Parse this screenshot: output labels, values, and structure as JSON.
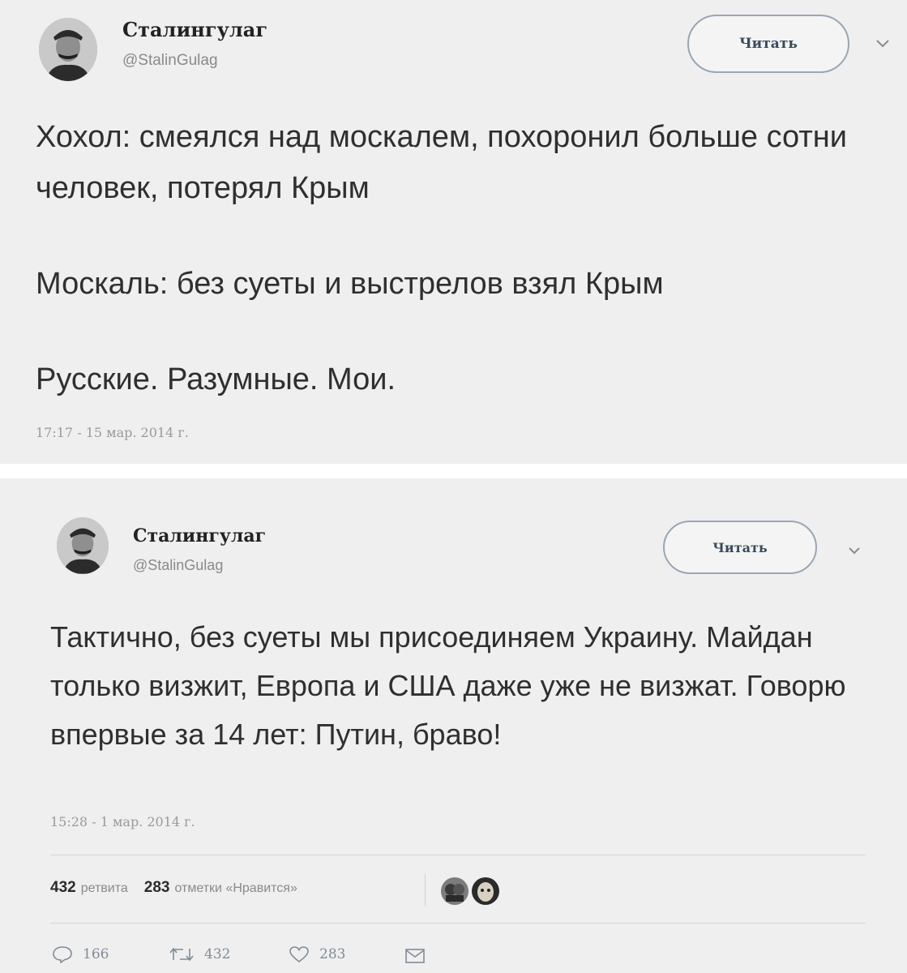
{
  "tweets": [
    {
      "author": {
        "name": "Сталингулаг",
        "handle": "@StalinGulag"
      },
      "follow_label": "Читать",
      "menu_icon": "chevron-down-icon",
      "text": [
        "Хохол: смеялся над москалем, похоронил больше сотни человек, потерял Крым",
        "Москаль: без суеты и выстрелов взял Крым",
        "Русские. Разумные. Мои."
      ],
      "timestamp": "17:17 - 15 мар. 2014 г."
    },
    {
      "author": {
        "name": "Сталингулаг",
        "handle": "@StalinGulag"
      },
      "follow_label": "Читать",
      "menu_icon": "chevron-down-icon",
      "text": [
        "Тактично, без суеты мы присоединяем Украину. Майдан только визжит, Европа и США даже уже не визжат. Говорю впервые за 14 лет: Путин, браво!"
      ],
      "timestamp": "15:28 - 1 мар. 2014 г.",
      "stats": {
        "retweets_count": "432",
        "retweets_label": "ретвита",
        "likes_count": "283",
        "likes_label": "отметки «Нравится»"
      },
      "actions": {
        "reply_icon": "reply-icon",
        "reply_count": "166",
        "retweet_icon": "retweet-icon",
        "retweet_count": "432",
        "like_icon": "heart-icon",
        "like_count": "283",
        "dm_icon": "envelope-icon"
      }
    }
  ],
  "colors": {
    "card_bg": "#efefef",
    "text": "#2f2f2f",
    "muted": "#8a8a8a",
    "button_border": "#9aa6b4"
  }
}
